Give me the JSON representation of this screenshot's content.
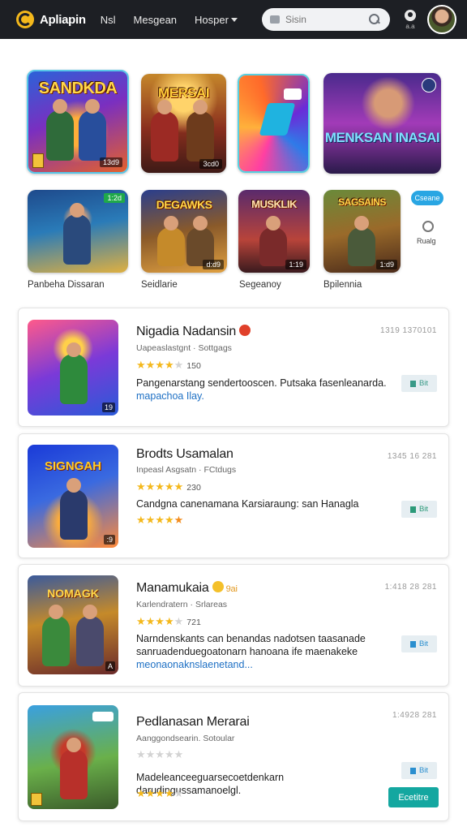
{
  "header": {
    "app_name": "Apliapin",
    "nav": [
      "Nsl",
      "Mesgean",
      "Hosper"
    ],
    "search_placeholder": "Sisin",
    "user_label": "a.a"
  },
  "featured": [
    {
      "title": "SANDKDA",
      "corner": "13d9"
    },
    {
      "title": "MERSAI",
      "corner": "3cd0"
    },
    {
      "title": "",
      "corner": ""
    },
    {
      "title": "MENKSAN INASAI",
      "corner": ""
    },
    {
      "title": "",
      "corner": "1:2d"
    },
    {
      "title": "DEGAWKS",
      "corner": "d:d9"
    },
    {
      "title": "MUSKLIK",
      "corner": "1:19"
    },
    {
      "title": "SAGSAINS",
      "corner": "1:d9"
    }
  ],
  "featured_captions": [
    "Panbeha Dissaran",
    "Seidlarie",
    "Segeanoy",
    "Bpilennia"
  ],
  "side": {
    "button": "Cseane",
    "label": "Rualg"
  },
  "cards": [
    {
      "title": "Nigadia Nadansin",
      "extra": "",
      "sub": "Uapeaslastgnt · Sottgags",
      "date": "1319 1370101",
      "rating": 4,
      "rating_count": "150",
      "desc": "Pangenarstang sendertooscen. Putsaka fasenleanarda.",
      "desc_link": "mapachoa Ilay.",
      "button": "Bit",
      "button_color": "#e6eef2",
      "button_text_color": "#3a9a88",
      "emoji_color": "#e0402a"
    },
    {
      "title": "Brodts Usamalan",
      "extra": "",
      "sub": "Inpeasl Asgsatn · FCtdugs",
      "date": "1345 16 281",
      "rating": 5,
      "rating_count": "230",
      "desc": "Candgna canenamana Karsiaraung: san Hanagla",
      "desc_link": "",
      "button": "Bit",
      "button_color": "#e6eef2",
      "button_text_color": "#2c9a79",
      "emoji_color": ""
    },
    {
      "title": "Manamukaia",
      "extra": "9ai",
      "sub": "Karlendratern · Srlareas",
      "date": "1:418 28 281",
      "rating": 4,
      "rating_count": "721",
      "desc": "Narndenskants can benandas nadotsen taasanade sanruadenduegoatonarn hanoana ife maenakeke",
      "desc_link": "meonaonaknslaenetand...",
      "button": "Bit",
      "button_color": "#e6eef2",
      "button_text_color": "#2b8fcf",
      "emoji_color": "#f4c02a"
    },
    {
      "title": "Pedlanasan Merarai",
      "extra": "",
      "sub": "Aanggondsearin. Sotoular",
      "date": "1:4928 281",
      "rating": 0,
      "rating_count": "",
      "desc": "Madeleanceeguarsecoetdenkarn darudingussamanoelgl.",
      "desc_link": "",
      "rating2": 4,
      "button": "Bit",
      "button_color": "#e6eef2",
      "button_text_color": "#2b8fcf",
      "button2": "Ecetitre",
      "emoji_color": ""
    }
  ]
}
